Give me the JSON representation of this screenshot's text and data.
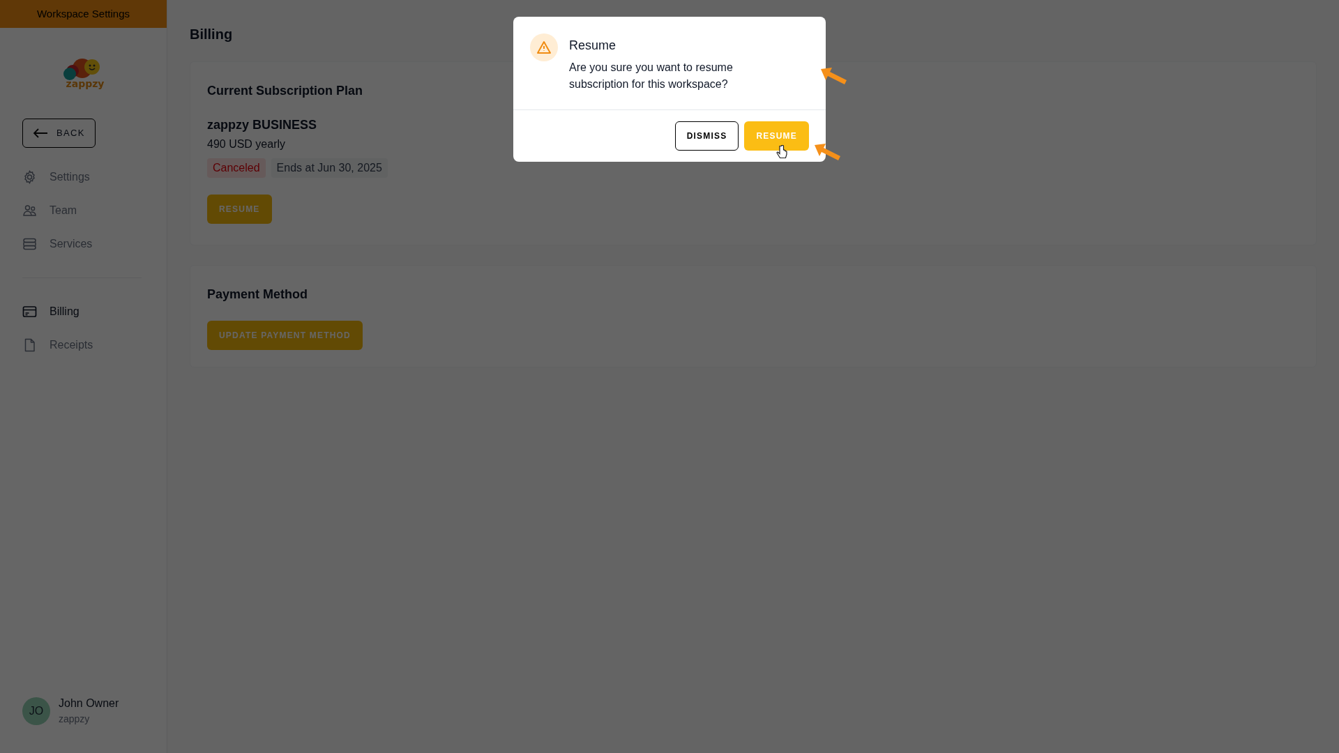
{
  "sidebar": {
    "header": "Workspace Settings",
    "logo_text": "zappzy",
    "back_button": "BACK",
    "nav_groups": [
      [
        {
          "label": "Settings",
          "kind": "gear",
          "selected": false
        },
        {
          "label": "Team",
          "kind": "users",
          "selected": false
        },
        {
          "label": "Services",
          "kind": "server",
          "selected": false
        }
      ],
      [
        {
          "label": "Billing",
          "kind": "card",
          "selected": true
        },
        {
          "label": "Receipts",
          "kind": "file",
          "selected": false
        }
      ]
    ],
    "user": {
      "initials": "JO",
      "name": "John Owner",
      "workspace": "zappzy"
    }
  },
  "page": {
    "title": "Billing",
    "subscription": {
      "heading": "Current Subscription Plan",
      "plan": "zappzy BUSINESS",
      "price": "490 USD yearly",
      "status": "Canceled",
      "ends": "Ends at Jun 30, 2025",
      "button": "RESUME"
    },
    "payment": {
      "heading": "Payment Method",
      "button": "UPDATE PAYMENT METHOD"
    }
  },
  "dialog": {
    "title": "Resume",
    "message": "Are you sure you want to resume subscription for this workspace?",
    "buttons": [
      {
        "label": "DISMISS",
        "kind": "secondary"
      },
      {
        "label": "RESUME",
        "kind": "primary"
      }
    ]
  }
}
